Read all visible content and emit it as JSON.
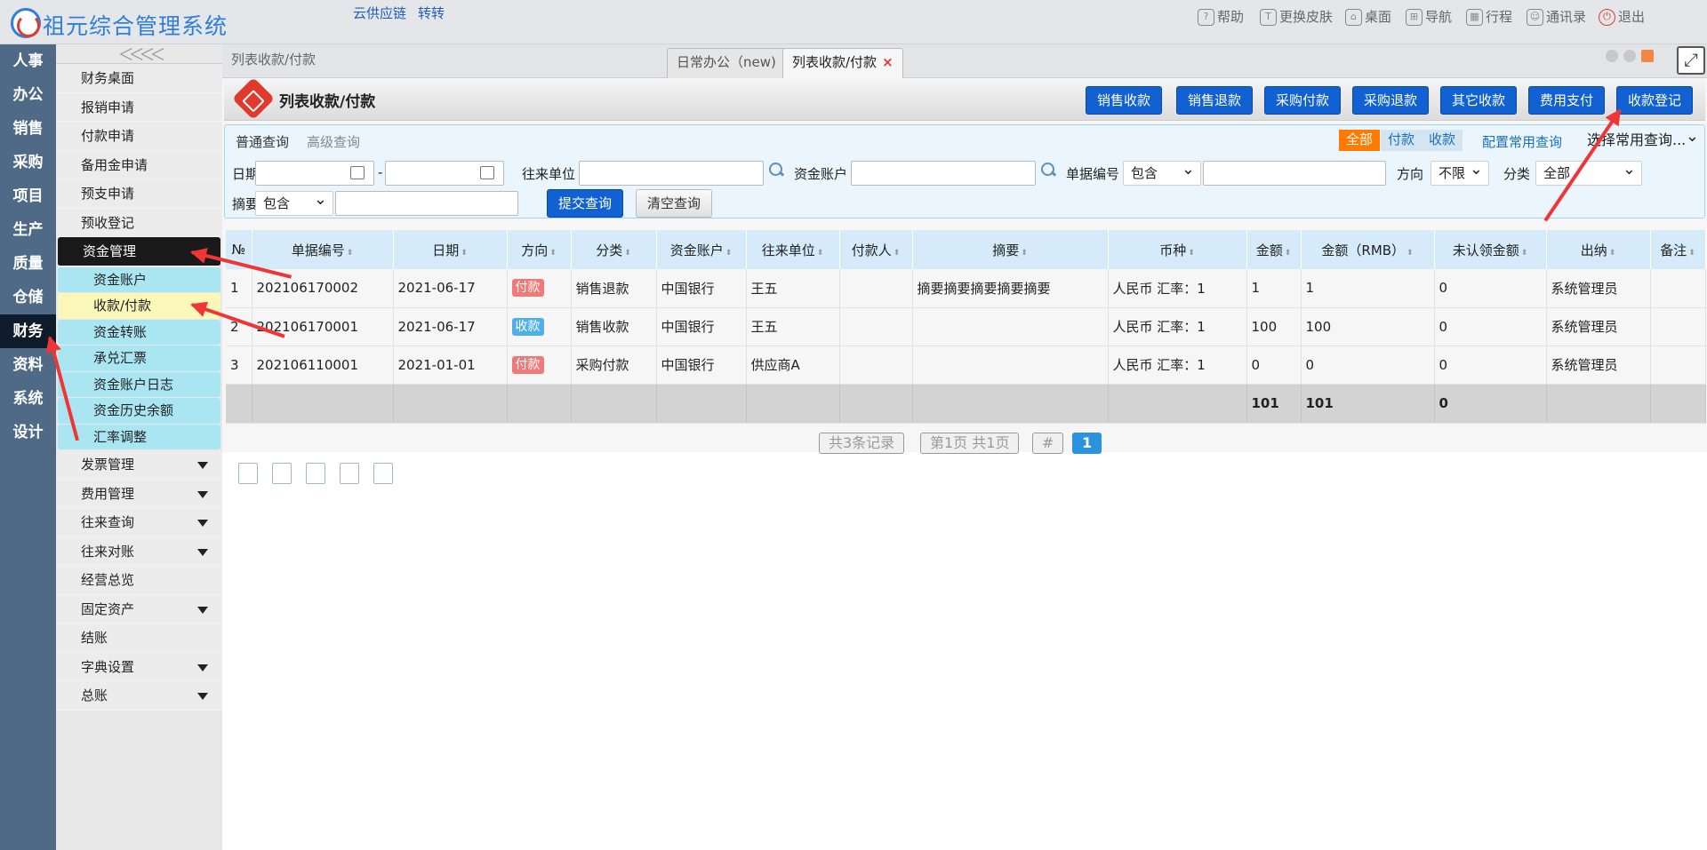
{
  "app": {
    "title": "祖元综合管理系统",
    "links": [
      "云供应链",
      "转转"
    ]
  },
  "topnav": [
    {
      "icon": "help-icon",
      "label": "帮助"
    },
    {
      "icon": "shirt-icon",
      "label": "更换皮肤"
    },
    {
      "icon": "home-icon",
      "label": "桌面"
    },
    {
      "icon": "grid-icon",
      "label": "导航"
    },
    {
      "icon": "calendar-icon",
      "label": "行程"
    },
    {
      "icon": "contact-icon",
      "label": "通讯录"
    },
    {
      "icon": "power-icon",
      "label": "退出"
    }
  ],
  "leftnav": [
    "人事",
    "办公",
    "销售",
    "采购",
    "项目",
    "生产",
    "质量",
    "仓储",
    "财务",
    "资料",
    "系统",
    "设计"
  ],
  "leftnav_active": "财务",
  "sidemenu": {
    "items_top": [
      "财务桌面",
      "报销申请",
      "付款申请",
      "备用金申请",
      "预支申请",
      "预收登记"
    ],
    "group": "资金管理",
    "subs": [
      "资金账户",
      "收款/付款",
      "资金转账",
      "承兑汇票",
      "资金账户日志",
      "资金历史余额",
      "汇率调整"
    ],
    "sub_active": "收款/付款",
    "items_bottom": [
      {
        "label": "发票管理",
        "arrow": true
      },
      {
        "label": "费用管理",
        "arrow": true
      },
      {
        "label": "往来查询",
        "arrow": true
      },
      {
        "label": "往来对账",
        "arrow": true
      },
      {
        "label": "经营总览",
        "arrow": false
      },
      {
        "label": "固定资产",
        "arrow": true
      },
      {
        "label": "结账",
        "arrow": false
      },
      {
        "label": "字典设置",
        "arrow": true
      },
      {
        "label": "总账",
        "arrow": true
      }
    ]
  },
  "breadcrumb": "列表收款/付款",
  "tabs": [
    {
      "label": "日常办公（new)",
      "active": false
    },
    {
      "label": "列表收款/付款",
      "active": true,
      "close": "×"
    }
  ],
  "page_title": "列表收款/付款",
  "toolbar_buttons": [
    "销售收款",
    "销售退款",
    "采购付款",
    "采购退款",
    "其它收款",
    "费用支付",
    "收款登记"
  ],
  "query": {
    "tab_normal": "普通查询",
    "tab_advanced": "高级查询",
    "seg": [
      "全部",
      "付款",
      "收款"
    ],
    "config": "配置常用查询",
    "common_select": "选择常用查询...",
    "date_label": "日期",
    "date_sep": "-",
    "partner_label": "往来单位",
    "account_label": "资金账户",
    "docno_label": "单据编号",
    "docno_op": "包含",
    "direction_label": "方向",
    "direction_value": "不限",
    "category_label": "分类",
    "category_value": "全部",
    "summary_label": "摘要",
    "summary_op": "包含",
    "submit": "提交查询",
    "clear": "清空查询"
  },
  "table": {
    "headers": [
      "№",
      "单据编号",
      "日期",
      "方向",
      "分类",
      "资金账户",
      "往来单位",
      "付款人",
      "摘要",
      "币种",
      "金额",
      "金额（RMB）",
      "未认领金额",
      "出纳",
      "备注"
    ],
    "rows": [
      {
        "no": "1",
        "doc": "202106170002",
        "date": "2021-06-17",
        "dir": "付款",
        "dirtype": "pay",
        "cat": "销售退款",
        "acct": "中国银行",
        "partner": "王五",
        "payer": "",
        "summary": "摘要摘要摘要摘要摘要",
        "currency": "人民币 汇率：1",
        "amount": "1",
        "rmb": "1",
        "unclaimed": "0",
        "cashier": "系统管理员",
        "note": ""
      },
      {
        "no": "2",
        "doc": "202106170001",
        "date": "2021-06-17",
        "dir": "收款",
        "dirtype": "rec",
        "cat": "销售收款",
        "acct": "中国银行",
        "partner": "王五",
        "payer": "",
        "summary": "",
        "currency": "人民币 汇率：1",
        "amount": "100",
        "rmb": "100",
        "unclaimed": "0",
        "cashier": "系统管理员",
        "note": ""
      },
      {
        "no": "3",
        "doc": "202106110001",
        "date": "2021-01-01",
        "dir": "付款",
        "dirtype": "pay",
        "cat": "采购付款",
        "acct": "中国银行",
        "partner": "供应商A",
        "payer": "",
        "summary": "",
        "currency": "人民币 汇率：1",
        "amount": "0",
        "rmb": "0",
        "unclaimed": "0",
        "cashier": "系统管理员",
        "note": ""
      }
    ],
    "totals": {
      "amount": "101",
      "rmb": "101",
      "unclaimed": "0"
    }
  },
  "pager": {
    "records": "共3条记录",
    "pages": "第1页 共1页",
    "jump": "#",
    "current": "1"
  }
}
